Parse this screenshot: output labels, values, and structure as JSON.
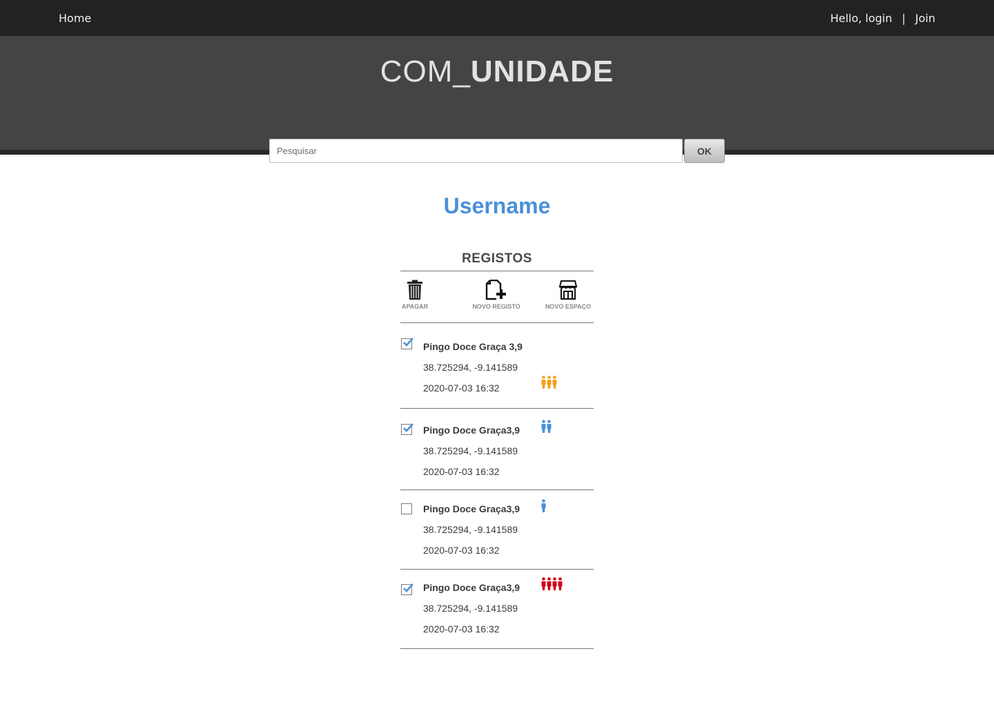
{
  "topbar": {
    "home": "Home",
    "greeting": "Hello, login",
    "separator": "|",
    "join": "Join"
  },
  "header": {
    "logo_light": "COM_",
    "logo_bold": "UNIDADE",
    "search_placeholder": "Pesquisar",
    "search_button": "OK"
  },
  "profile": {
    "username": "Username"
  },
  "registos": {
    "title": "REGISTOS",
    "actions": {
      "delete": {
        "label": "APAGAR",
        "icon": "trash-icon"
      },
      "new_record": {
        "label": "NOVO REGISTO",
        "icon": "file-plus-icon"
      },
      "new_space": {
        "label": "NOVO ESPAÇO",
        "icon": "store-icon"
      }
    },
    "items": [
      {
        "name": "Pingo Doce Graça 3,9",
        "coords": "38.725294, -9.141589",
        "datetime": "2020-07-03 16:32",
        "checked": true,
        "people": 3,
        "color": "#f0a21b"
      },
      {
        "name": "Pingo Doce Graça3,9",
        "coords": "38.725294, -9.141589",
        "datetime": "2020-07-03 16:32",
        "checked": true,
        "people": 2,
        "color": "#4a90d9"
      },
      {
        "name": "Pingo Doce Graça3,9",
        "coords": "38.725294, -9.141589",
        "datetime": "2020-07-03 16:32",
        "checked": false,
        "people": 1,
        "color": "#4a90d9"
      },
      {
        "name": "Pingo Doce Graça3,9",
        "coords": "38.725294, -9.141589",
        "datetime": "2020-07-03 16:32",
        "checked": true,
        "people": 4,
        "color": "#d0021b"
      }
    ]
  }
}
